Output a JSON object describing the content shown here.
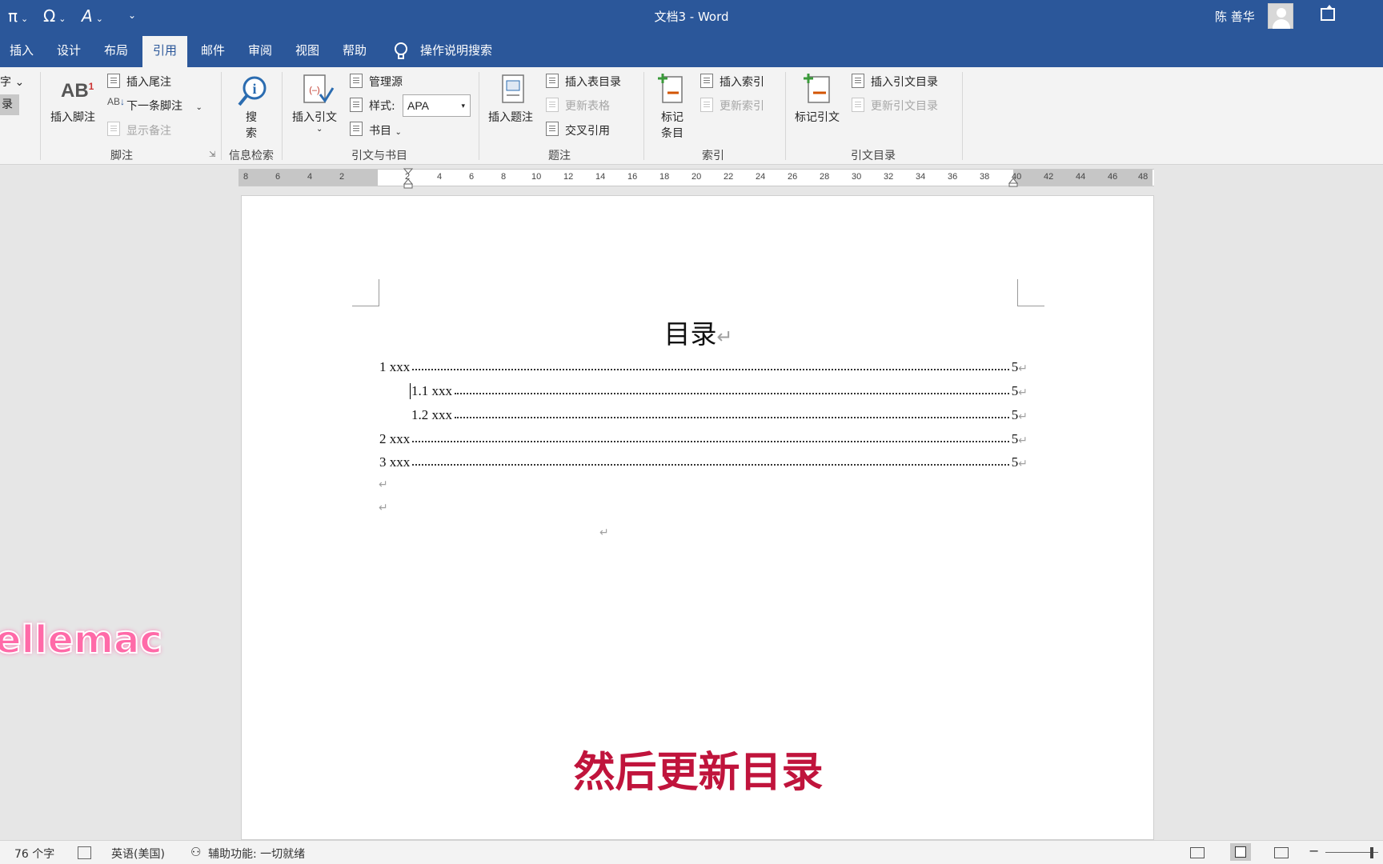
{
  "window": {
    "doc_title": "文档3  -  Word",
    "user_name": "陈 善华",
    "quick_access": [
      "π",
      "Ω",
      "A"
    ]
  },
  "tabs": [
    "插入",
    "设计",
    "布局",
    "引用",
    "邮件",
    "审阅",
    "视图",
    "帮助"
  ],
  "active_tab": "引用",
  "tell_me": "操作说明搜索",
  "ribbon": {
    "partial": {
      "item1": "字",
      "item2": "录"
    },
    "footnotes": {
      "insert_footnote": "插入脚注",
      "insert_endnote": "插入尾注",
      "next_footnote": "下一条脚注",
      "show_notes": "显示备注",
      "group": "脚注"
    },
    "research": {
      "search_line1": "搜",
      "search_line2": "索",
      "group": "信息检索"
    },
    "citations": {
      "insert_citation": "插入引文",
      "manage_sources": "管理源",
      "style_label": "样式:",
      "style_value": "APA",
      "bibliography": "书目",
      "group": "引文与书目"
    },
    "captions": {
      "insert_caption": "插入题注",
      "insert_table_of_figures": "插入表目录",
      "update_table": "更新表格",
      "cross_reference": "交叉引用",
      "group": "题注"
    },
    "index": {
      "mark_entry_line1": "标记",
      "mark_entry_line2": "条目",
      "insert_index": "插入索引",
      "update_index": "更新索引",
      "group": "索引"
    },
    "authorities": {
      "mark_citation": "标记引文",
      "insert_table_of_authorities": "插入引文目录",
      "update_table_of_authorities": "更新引文目录",
      "group": "引文目录"
    }
  },
  "ruler_ticks": [
    "8",
    "6",
    "4",
    "2",
    "2",
    "4",
    "6",
    "8",
    "10",
    "12",
    "14",
    "16",
    "18",
    "20",
    "22",
    "24",
    "26",
    "28",
    "30",
    "32",
    "34",
    "36",
    "38",
    "40",
    "42",
    "44",
    "46",
    "48"
  ],
  "document": {
    "toc_title": "目录",
    "toc_entries": [
      {
        "label": "1 xxx",
        "page": "5"
      },
      {
        "label": "1.1 xxx",
        "page": "5"
      },
      {
        "label": "1.2 xxx",
        "page": "5"
      },
      {
        "label": "2 xxx",
        "page": "5"
      },
      {
        "label": "3 xxx",
        "page": "5"
      }
    ],
    "paragraph_mark": "↵"
  },
  "overlay": {
    "caption": "然后更新目录",
    "watermark": "ellemac"
  },
  "status": {
    "word_count": "76 个字",
    "language": "英语(美国)",
    "accessibility": "辅助功能: 一切就绪"
  },
  "colors": {
    "word_blue": "#2b579a",
    "caption_red": "#c0143c",
    "watermark_pink": "#ff6aa8"
  }
}
